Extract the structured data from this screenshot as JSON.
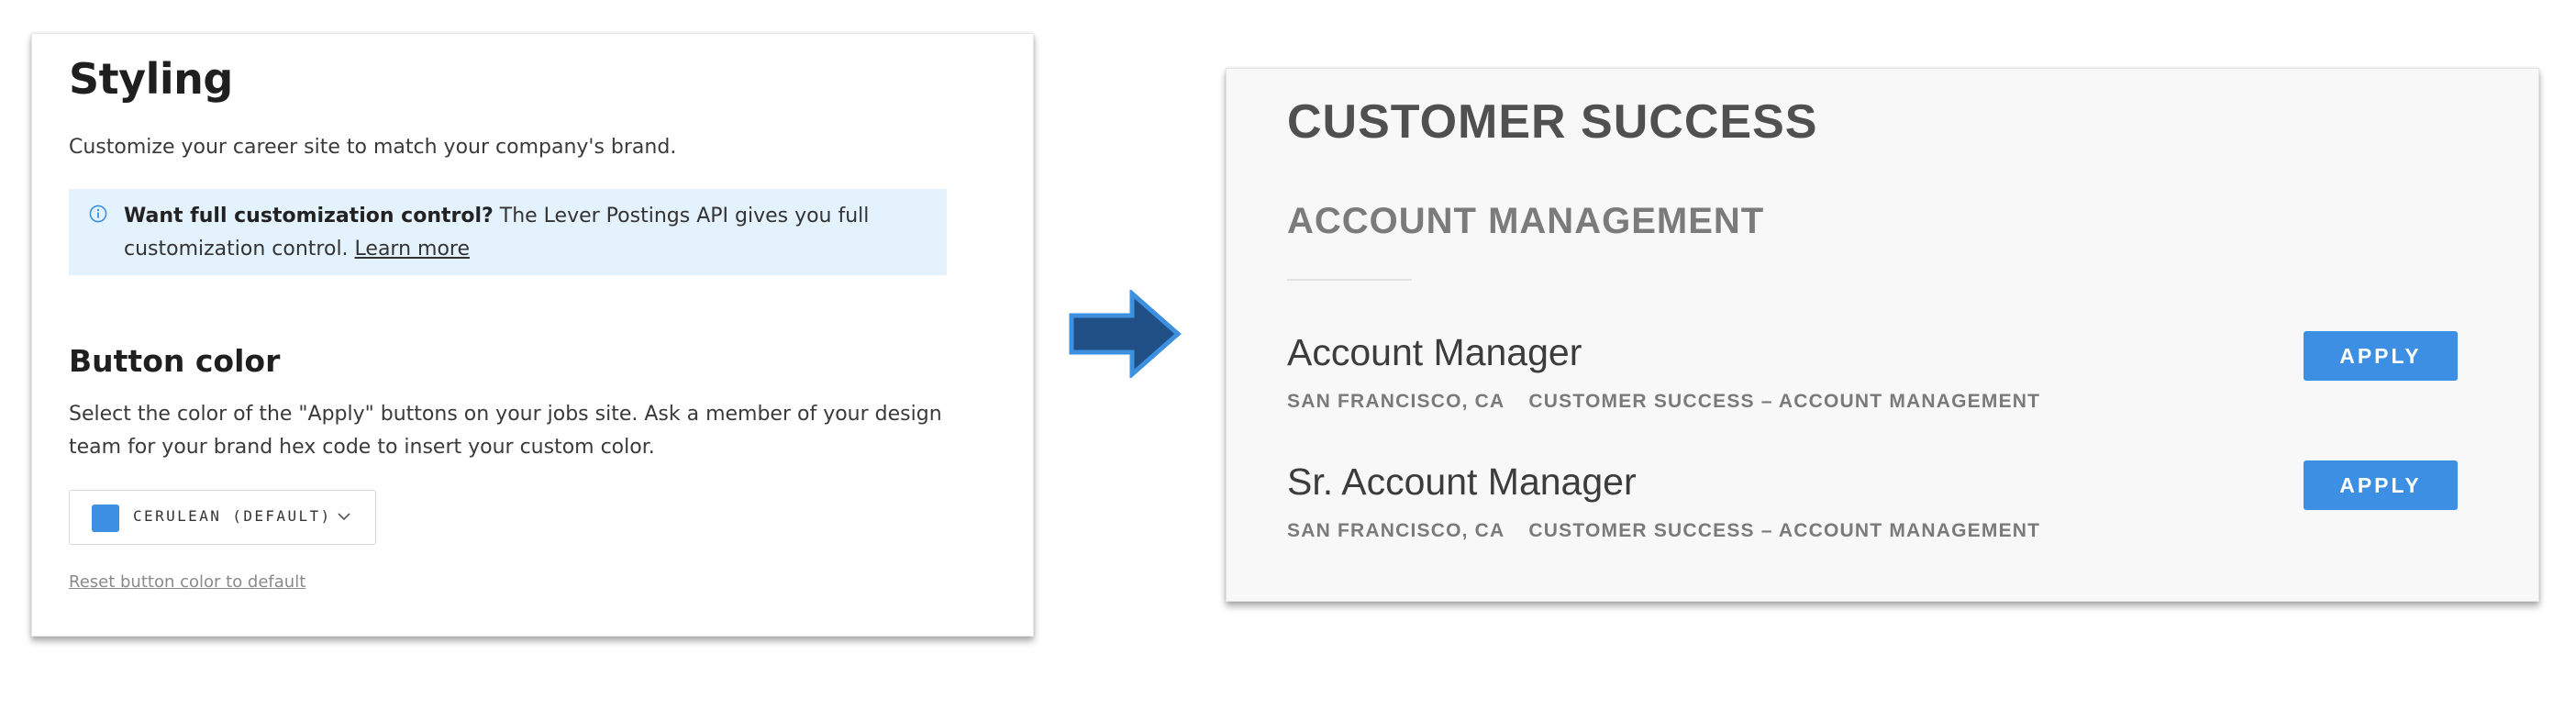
{
  "settings": {
    "title": "Styling",
    "description": "Customize your career site to match your company's brand.",
    "callout": {
      "bold": "Want full customization control?",
      "text": " The Lever Postings API gives you full customization control. ",
      "link": "Learn more"
    },
    "button_color": {
      "heading": "Button color",
      "description": "Select the color of the \"Apply\" buttons on your jobs site. Ask a member of your design team for your brand hex code to insert your custom color.",
      "selected_label": "CERULEAN (DEFAULT)",
      "selected_color": "#3c8fe3",
      "reset_link": "Reset button color to default"
    }
  },
  "arrow": {
    "color": "#1f4f85",
    "outline": "#3d8fe0"
  },
  "preview": {
    "department": "CUSTOMER SUCCESS",
    "team": "ACCOUNT MANAGEMENT",
    "apply_color": "#3c8fe3",
    "postings": [
      {
        "title": "Account Manager",
        "location": "SAN FRANCISCO, CA",
        "category": "CUSTOMER SUCCESS – ACCOUNT MANAGEMENT",
        "apply_label": "APPLY"
      },
      {
        "title": "Sr. Account Manager",
        "location": "SAN FRANCISCO, CA",
        "category": "CUSTOMER SUCCESS – ACCOUNT MANAGEMENT",
        "apply_label": "APPLY"
      }
    ]
  }
}
